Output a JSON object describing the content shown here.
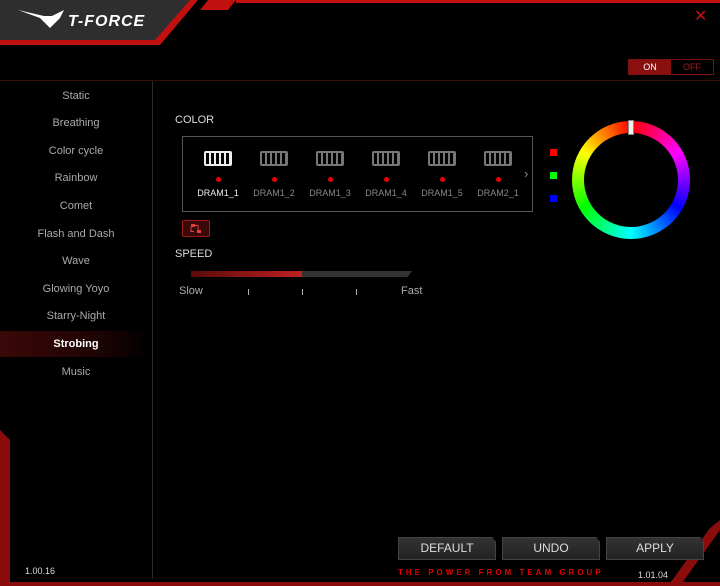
{
  "header": {
    "logo": "T-FORCE",
    "close_icon": "close-icon"
  },
  "power": {
    "on": "ON",
    "off": "OFF",
    "state": "ON"
  },
  "sidebar": {
    "items": [
      {
        "label": "Static"
      },
      {
        "label": "Breathing"
      },
      {
        "label": "Color cycle"
      },
      {
        "label": "Rainbow"
      },
      {
        "label": "Comet"
      },
      {
        "label": "Flash and Dash"
      },
      {
        "label": "Wave"
      },
      {
        "label": "Glowing Yoyo"
      },
      {
        "label": "Starry-Night"
      },
      {
        "label": "Strobing"
      },
      {
        "label": "Music"
      }
    ],
    "active": "Strobing"
  },
  "color": {
    "label": "COLOR",
    "modules": [
      {
        "label": "DRAM1_1"
      },
      {
        "label": "DRAM1_2"
      },
      {
        "label": "DRAM1_3"
      },
      {
        "label": "DRAM1_4"
      },
      {
        "label": "DRAM1_5"
      },
      {
        "label": "DRAM2_1"
      }
    ],
    "selected": "DRAM1_1",
    "rgb": [
      "#ff0000",
      "#00ff00",
      "#0000ff"
    ]
  },
  "speed": {
    "label": "SPEED",
    "slow": "Slow",
    "fast": "Fast",
    "value_fraction": 0.5
  },
  "buttons": {
    "default": "DEFAULT",
    "undo": "UNDO",
    "apply": "APPLY"
  },
  "footer": {
    "tagline": "THE POWER FROM TEAM GROUP",
    "version_left": "1.00.16",
    "version_right": "1.01.04"
  }
}
